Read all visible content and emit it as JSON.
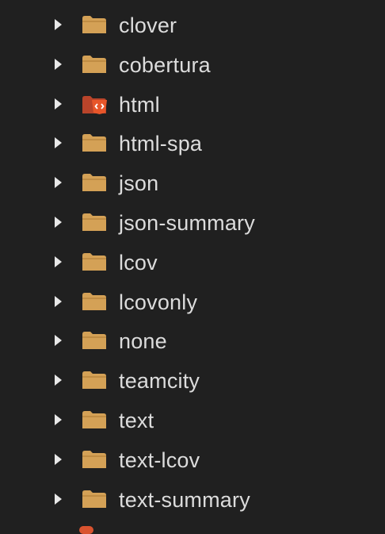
{
  "colors": {
    "background": "#202020",
    "folder": "#d4a156",
    "html_folder": "#c84a2c",
    "html_badge": "#e8562a",
    "text": "#dcdcdc",
    "chevron": "#e8e8e8"
  },
  "explorer": {
    "items": [
      {
        "label": "clover",
        "icon": "folder-icon"
      },
      {
        "label": "cobertura",
        "icon": "folder-icon"
      },
      {
        "label": "html",
        "icon": "html-folder-icon"
      },
      {
        "label": "html-spa",
        "icon": "folder-icon"
      },
      {
        "label": "json",
        "icon": "folder-icon"
      },
      {
        "label": "json-summary",
        "icon": "folder-icon"
      },
      {
        "label": "lcov",
        "icon": "folder-icon"
      },
      {
        "label": "lcovonly",
        "icon": "folder-icon"
      },
      {
        "label": "none",
        "icon": "folder-icon"
      },
      {
        "label": "teamcity",
        "icon": "folder-icon"
      },
      {
        "label": "text",
        "icon": "folder-icon"
      },
      {
        "label": "text-lcov",
        "icon": "folder-icon"
      },
      {
        "label": "text-summary",
        "icon": "folder-icon"
      }
    ]
  }
}
